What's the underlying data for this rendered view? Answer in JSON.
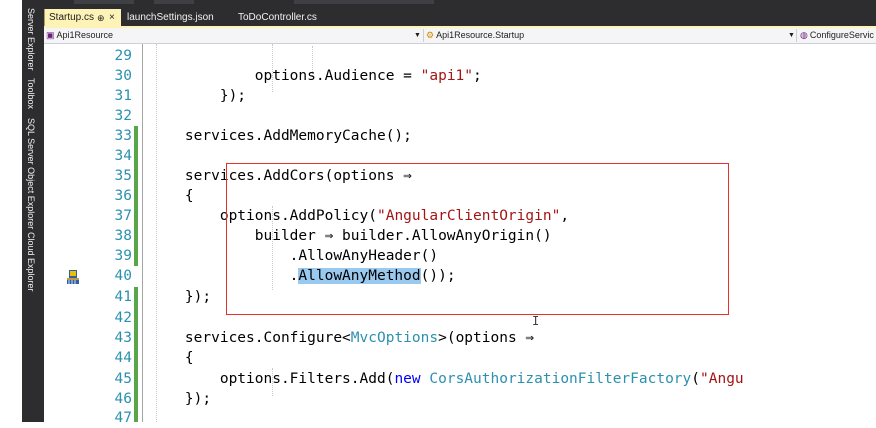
{
  "sidebar": {
    "items": [
      "Server Explorer",
      "Toolbox",
      "SQL Server Object Explorer",
      "Cloud Explorer"
    ]
  },
  "tabs": [
    {
      "label": "Startup.cs",
      "pin": "⊕",
      "close": "×",
      "active": true
    },
    {
      "label": "launchSettings.json",
      "active": false
    },
    {
      "label": "ToDoController.cs",
      "active": false
    }
  ],
  "navbar": {
    "project": "Api1Resource",
    "type": "Api1Resource.Startup",
    "member": "ConfigureServic"
  },
  "line_numbers": [
    "29",
    "30",
    "31",
    "32",
    "33",
    "34",
    "35",
    "36",
    "37",
    "38",
    "39",
    "40",
    "41",
    "42",
    "43",
    "44",
    "45",
    "46",
    "47"
  ],
  "code": {
    "l30": {
      "a": "            options.Audience = ",
      "b": "\"api1\"",
      "c": ";"
    },
    "l31": "        });",
    "l33": "    services.AddMemoryCache();",
    "l35": "    services.AddCors(options ⇒",
    "l36": "    {",
    "l37": {
      "a": "        options.AddPolicy(",
      "b": "\"AngularClientOrigin\"",
      "c": ","
    },
    "l38": "            builder ⇒ builder.AllowAnyOrigin()",
    "l39": "                .AllowAnyHeader()",
    "l40": {
      "a": "                .",
      "b": "AllowAnyMethod",
      "c": "());"
    },
    "l41": "    });",
    "l43": {
      "a": "    services.Configure<",
      "b": "MvcOptions",
      "c": ">(options ⇒"
    },
    "l44": "    {",
    "l45": {
      "a": "        options.Filters.Add(",
      "b": "new",
      "c": " ",
      "d": "CorsAuthorizationFilterFactory",
      "e": "(",
      "f": "\"Angu"
    },
    "l46": "    });"
  },
  "colors": {
    "string": "#a31515",
    "keyword": "#0000ff",
    "type": "#2b91af",
    "line_number": "#2b91af",
    "change_marker": "#57a64a",
    "highlight_box": "#e8302a",
    "selection": "#99c9ef"
  },
  "icons": {
    "quick_actions": "lightbulb-brush-icon",
    "caret": "text-cursor-icon"
  }
}
